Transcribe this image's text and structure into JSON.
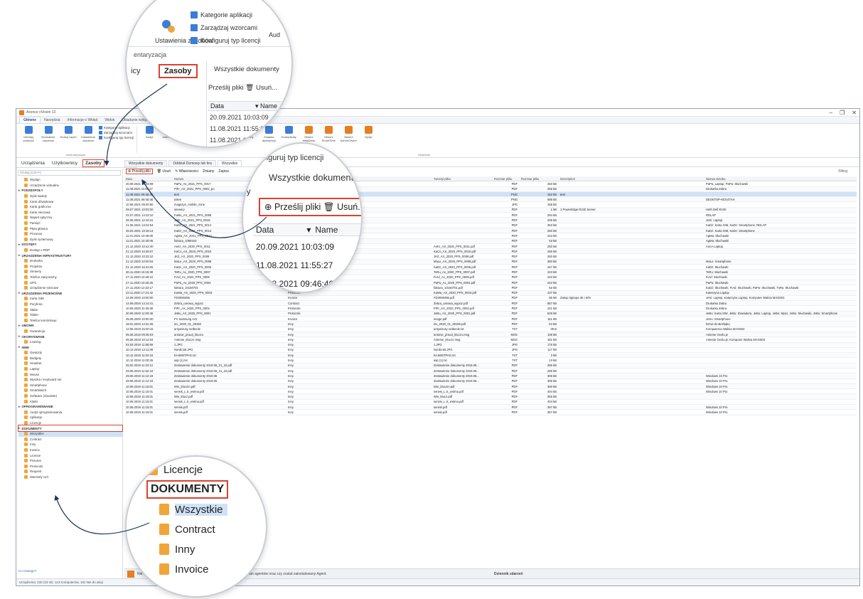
{
  "window": {
    "title": "Axence nVision 13",
    "controls": [
      "–",
      "❐",
      "✕"
    ]
  },
  "menu_tabs": [
    "Główne",
    "Narzędzia",
    "Informacje o Wkład",
    "Widok",
    "Układanie wyłączeń"
  ],
  "ribbon": {
    "buttons": [
      {
        "label": "Genetyj podsuidi",
        "color": "#3b7dd8"
      },
      {
        "label": "Normalizer zasobów",
        "color": "#3b7dd8"
      },
      {
        "label": "Drukuj raport",
        "color": "#3b7dd8"
      },
      {
        "label": "Ustawienia zasobów",
        "color": "#3b7dd8"
      },
      {
        "label": "Audyt",
        "color": "#3b7dd8"
      },
      {
        "label": "Ustawienia",
        "color": "#3b7dd8"
      },
      {
        "label": "Konfiguruj typ licencji",
        "color": "#3b7dd8"
      },
      {
        "label": "Procedury",
        "color": "#3b7dd8"
      },
      {
        "label": "Historia",
        "color": "#3b7dd8"
      },
      {
        "label": "Alarmy",
        "color": "#3b7dd8"
      },
      {
        "label": "Zadania dystrybucji",
        "color": "#3b7dd8"
      },
      {
        "label": "Komunikaty",
        "color": "#3b7dd8"
      },
      {
        "label": "Otwórz HelpDesk",
        "color": "#e67e22"
      },
      {
        "label": "Otwórz SmartTime",
        "color": "#e67e22"
      },
      {
        "label": "Otwórz AdminCenter",
        "color": "#e67e22"
      },
      {
        "label": "Opcje",
        "color": "#e67e22"
      }
    ],
    "small_items": [
      "Kategorie aplikacji",
      "Zarządzaj wzorcami",
      "Konfiguruj typ licencji"
    ],
    "group_inwentaryzacja": "Inwentaryzacja",
    "group_helpdesk": "HelpDesk"
  },
  "nav_tabs": [
    "Urządzenia",
    "Użytkownicy",
    "Zasoby"
  ],
  "sidebar": {
    "search_placeholder": "Szukaj (Ctrl+F)",
    "tree": [
      {
        "t": "Wydajn",
        "k": "leaf"
      },
      {
        "t": "Urządzenie wirtualne",
        "k": "leaf"
      },
      {
        "t": "PODZESPOŁY",
        "k": "cat"
      },
      {
        "t": "Dysk twardy",
        "k": "leaf"
      },
      {
        "t": "Karta dźwiękowa",
        "k": "leaf"
      },
      {
        "t": "Karta graficzna",
        "k": "leaf"
      },
      {
        "t": "Karta sieciowa",
        "k": "leaf"
      },
      {
        "t": "Napęd optyczny",
        "k": "leaf"
      },
      {
        "t": "Pamięć",
        "k": "leaf"
      },
      {
        "t": "Płyta główna",
        "k": "leaf"
      },
      {
        "t": "Procesor",
        "k": "leaf"
      },
      {
        "t": "Dysk systemowy",
        "k": "leaf"
      },
      {
        "t": "DOSTĘPY",
        "k": "cat"
      },
      {
        "t": "Dostęp o RDP",
        "k": "leaf"
      },
      {
        "t": "URZĄDZENIA INFRASTRUKTURY",
        "k": "cat"
      },
      {
        "t": "Drukarka",
        "k": "leaf"
      },
      {
        "t": "Projektor",
        "k": "leaf"
      },
      {
        "t": "Serwery",
        "k": "leaf"
      },
      {
        "t": "Telefon stacjonarny",
        "k": "leaf"
      },
      {
        "t": "UPS",
        "k": "leaf"
      },
      {
        "t": "Urządzenie sieciowe",
        "k": "leaf"
      },
      {
        "t": "URZĄDZENIA PRZENOŚNE",
        "k": "cat"
      },
      {
        "t": "Karta SIM",
        "k": "leaf"
      },
      {
        "t": "Peryferia",
        "k": "leaf"
      },
      {
        "t": "Słabe",
        "k": "leaf"
      },
      {
        "t": "Tablet",
        "k": "leaf"
      },
      {
        "t": "Telefon komórkowy",
        "k": "leaf"
      },
      {
        "t": "UMOWA",
        "k": "cat"
      },
      {
        "t": "Gwarancja",
        "k": "leaf"
      },
      {
        "t": "OKORVSWANE",
        "k": "cat"
      },
      {
        "t": "Leasing",
        "k": "leaf"
      },
      {
        "t": "INNE",
        "k": "cat"
      },
      {
        "t": "Gwiazdy",
        "k": "leaf"
      },
      {
        "t": "Budgety",
        "k": "leaf"
      },
      {
        "t": "Headset",
        "k": "leaf"
      },
      {
        "t": "Laptop",
        "k": "leaf"
      },
      {
        "t": "Mouse",
        "k": "leaf"
      },
      {
        "t": "Myszka / Keyboard set",
        "k": "leaf"
      },
      {
        "t": "Smartphone",
        "k": "leaf"
      },
      {
        "t": "Smartwatch",
        "k": "leaf"
      },
      {
        "t": "Software (obsolete)",
        "k": "leaf"
      },
      {
        "t": "Klatki",
        "k": "leaf"
      },
      {
        "t": "OPROGRAMOWANIE",
        "k": "cat"
      },
      {
        "t": "Audyt oprogramowania",
        "k": "leaf"
      },
      {
        "t": "Aplikacje",
        "k": "leaf"
      },
      {
        "t": "Licencje",
        "k": "leaf"
      },
      {
        "t": "DOKUMENTY",
        "k": "cat",
        "hl": true
      },
      {
        "t": "Wszystkie",
        "k": "leaf",
        "sel": true
      },
      {
        "t": "Contract",
        "k": "leaf"
      },
      {
        "t": "Inny",
        "k": "leaf"
      },
      {
        "t": "Invoice",
        "k": "leaf"
      },
      {
        "t": "License",
        "k": "leaf"
      },
      {
        "t": "Pictures",
        "k": "leaf"
      },
      {
        "t": "Protocols",
        "k": "leaf"
      },
      {
        "t": "Request",
        "k": "leaf"
      },
      {
        "t": "Warranty cert",
        "k": "leaf"
      }
    ],
    "footer": "Co nowego?"
  },
  "doc_tabs": [
    "Wszystkie dokumenty",
    "Oddział Domowy lub bra",
    "Wszystkie"
  ],
  "doc_toolbar": {
    "upload": "Prześlij pliki",
    "delete": "Usuń",
    "properties": "Właściwości",
    "download": "Zmiany",
    "save": "Zapisz",
    "filter": "Filtruj:"
  },
  "grid": {
    "columns": [
      "Data",
      "Nazwa",
      "Typ",
      "Tworzył pliku",
      "Rozmiar pliku",
      "Rozmiar pliku",
      "Description",
      "Nazwa zasobu"
    ],
    "rows": [
      [
        "20.09.2021 10:03:09",
        "PaPa_As_2021_PPS_0017",
        "",
        "",
        "PDF",
        "250 kB",
        "",
        "PaPa: Laptop, PaPa: Słuchawki"
      ],
      [
        "11.08.2021 11:55:27",
        "PiFr_AX_2021_PPS_0002_po",
        "",
        "",
        "PDF",
        "255 kB",
        "",
        "Drukarka Zebra"
      ],
      [
        "11.08.2021 09:46:46",
        "test",
        "",
        "",
        "PNG",
        "152 kB",
        "test",
        "",
        true
      ],
      [
        "11.08.2021 09:45:45",
        "token",
        "",
        "",
        "PNG",
        "595 kB",
        "",
        "DESKTOP-KEG4TAH"
      ],
      [
        "10.08.2021 09:40:50",
        "magazyn_mobile_zone",
        "",
        "",
        "JPG",
        "158 kB",
        "",
        ""
      ],
      [
        "09.07.2021 10:03:20",
        "serwery",
        "",
        "",
        "PDF",
        "1 kB",
        "1 PowerEdge R240 Server",
        "Hoth Dell R240"
      ],
      [
        "02.07.2021 14:23:10",
        "Faktu_AX_2021_PPS_0006",
        "",
        "",
        "PDF",
        "294 kB",
        "",
        "RDLAP"
      ],
      [
        "26.06.2021 12:10:41",
        "JeBr_AX_2021_PPS_0016",
        "",
        "",
        "PDF",
        "235 kB",
        "",
        "JeSi: Laptop"
      ],
      [
        "21.06.2021 13:24:54",
        "KaDz_AX_2021_PPS_0014",
        "",
        "",
        "PDF",
        "353 kB",
        "",
        "KaDz: Karta SIM, KaDz: Smartphone, RDLAP"
      ],
      [
        "28.02.2021 10:18:14",
        "KaDz_AX_2021_PPS_0013",
        "",
        "",
        "PDF",
        "260 kB",
        "",
        "KaDz: Karta SIM, KaDz: Smartphone"
      ],
      [
        "11.01.2021 10:45:06",
        "AgMa_AX_2021_PPS_0012",
        "",
        "",
        "PDF",
        "243 kB",
        "",
        "AgMa: Słuchawki"
      ],
      [
        "11.01.2021 10:40:06",
        "faktura_1098343",
        "",
        "",
        "PDF",
        "53 kB",
        "",
        "AgMa: Słuchawki"
      ],
      [
        "21.12.2020 10:42:40",
        "AnKr_AX_2020_PPS_0011",
        "Protocols",
        "AnKr_AX_2020_PPS_0011.pdf",
        "PDF",
        "250 kB",
        "",
        "AnnA Laptop"
      ],
      [
        "21.12.2020 10:35:07",
        "KaCo_AX_2020_PPS_0010",
        "Protocols",
        "KaCo_AX_2020_PPS_0010.pdf",
        "PDF",
        "255 kB",
        "",
        ""
      ],
      [
        "21.12.2020 10:33:10",
        "JKZ_AX_2020_PPS_0009",
        "Protocols",
        "JKZ_AX_2020_PPS_0009.pdf",
        "PDF",
        "250 kB",
        "",
        ""
      ],
      [
        "21.12.2020 10:00:04",
        "MaLe_AX_2020_PPS_0008",
        "Protocols",
        "MaLe_AX_2020_PPS_0008.pdf",
        "PDF",
        "350 kB",
        "",
        "MaLe: Smartphone"
      ],
      [
        "01.12.2020 16:23:25",
        "KaDz_AX_2020_PPS_0005",
        "Protocols",
        "KaDz_AX_2020_PPS_0005.pdf",
        "PDF",
        "247 kB",
        "",
        "KaDz: Słuchawki"
      ],
      [
        "30.11.2020 15:15:38",
        "ToRu_Ax_2020_PPS_0007",
        "Protocols",
        "ToRu_Ax_2020_PPS_0007.pdf",
        "PDF",
        "243 kB",
        "",
        "ToRu: Słuchawki"
      ],
      [
        "27.11.2020 10:46:24",
        "FiAd_Ax_2020_PPS_0006",
        "Protocols",
        "FiAd_Ax_2020_PPS_0006.pdf",
        "PDF",
        "243 kB",
        "",
        "FiAd: Słuchawki"
      ],
      [
        "27.11.2020 10:40:25",
        "PaPa_Ax_2020_PPS_0004",
        "Protocols",
        "PaPa_Ax_2020_PPS_0004.pdf",
        "PDF",
        "243 kB",
        "",
        "PaPa: Słuchawki"
      ],
      [
        "27.11.2020 12:23:17",
        "faktura_10150701",
        "Invoice",
        "faktura_10150701.pdf",
        "PDF",
        "82 kB",
        "",
        "KaDz: Słuchawki, FiAd: Słuchawki, PaPa: Słuchawki, ToRu: Słuchawki"
      ],
      [
        "23.11.2020 17:21:42",
        "KaWa_AX_2020_PPS_0003",
        "Protocols",
        "KaWa_AX_2020_PPS_0003.pdf",
        "PDF",
        "237 kB",
        "",
        "Katarzyna Laptop"
      ],
      [
        "24.09.2020 10:50:00",
        "FD0090455",
        "Invoice",
        "FD0090455.pdf",
        "PDF",
        "85 kB",
        "Zakup laptopa 4K i IEN",
        "JeSi: Laptop, Katarzyna Laptop, Komputer Walnia MAG503"
      ],
      [
        "14.09.2020 14:14:41",
        "Zebra_umowa_wypoz",
        "Contract",
        "Zebra_umowa_wypoz.pdf",
        "PDF",
        "857 kB",
        "",
        "Drukarka Zebra"
      ],
      [
        "10.09.2020 11:45:38",
        "PiPr_AX_2020_PPS_0002",
        "Protocols",
        "PiPr_AX_2020_PPS_0002.pdf",
        "PDF",
        "241 kB",
        "",
        "Drukarka Zebra"
      ],
      [
        "30.09.2020 11:00:46",
        "JeBu_AX_2020_PPS_0001",
        "Protocols",
        "JeBu_AX_2020_PPS_0001.pdf",
        "PDF",
        "528 kB",
        "",
        "JeBu: Karta SIM, JeBu: Klawiatura, JeBu: Laptop, JeBu: Mysz, JeBu: Słuchawki, JeBu: Smartphone"
      ],
      [
        "25.06.2020 10:00:30",
        "FV Samsung A41",
        "Invoice",
        "image.pdf",
        "PDF",
        "151 kB",
        "",
        "JeSu: Smartphone"
      ],
      [
        "18.01.2020 14:31:25",
        "inv_2020_01_28150",
        "Inny",
        "inv_2020_01_28150.pdf",
        "PDF",
        "64 kB",
        "",
        "Drzwi do Bezbąku"
      ],
      [
        "12.06.2019 15:40:15",
        "antywirusy netbeole",
        "Inny",
        "antywirusy netbeole.txt",
        "TXT",
        "39 B",
        "",
        "Komputeroo Walnia MAG503"
      ],
      [
        "05.06.2019 09:35:03",
        "antonie_proud_kluczo",
        "Inny",
        "antonie_proud_kluczo.msg",
        "MSG",
        "108 kB",
        "",
        "Antenie Geolu.je"
      ],
      [
        "05.06.2019 10:12:04",
        "Antenie_kluczo msg",
        "Inny",
        "Antenie_kluczo msg",
        "MSG",
        "161 kB",
        "",
        "Antenie Geolu.je, Komputer Walnia MAG503"
      ],
      [
        "04.03.2019 11:58:59",
        "1.JPG",
        "Inny",
        "1.JPG",
        "JPG",
        "175 kB",
        "",
        ""
      ],
      [
        "10.12.2018 13:11:08",
        "Nordic1B.JPG",
        "Inny",
        "Nordic1B.JPG",
        "JPG",
        "117 kB",
        "",
        ""
      ],
      [
        "10.12.2018 11:02:16",
        "EASEBTPAG.txt",
        "Inny",
        "EASEBTPAG.txt",
        "TXT",
        "2 kB",
        "",
        ""
      ],
      [
        "10.12.2018 11:00:26",
        "asp (1).txt",
        "Inny",
        "asp (1).txt",
        "TXT",
        "13 kB",
        "",
        ""
      ],
      [
        "26.02.2019 11:23:12",
        "Zestawienie dokumenty 2019.06_21_22.pdf",
        "Inny",
        "Zestawienie dokumenty 2019.06...",
        "PDF",
        "286 kB",
        "",
        ""
      ],
      [
        "29.06.2019 11:52:18",
        "Zestawienie dokumenty 2019.06_21_22.pdf",
        "Inny",
        "Zestawienie dokumenty 2019.06...",
        "PDF",
        "285 kB",
        "",
        ""
      ],
      [
        "29.06.2019 11:12:18",
        "Zestawienie dokumenty 2019.06",
        "Inny",
        "Zestawienie dokumenty 2019.06...",
        "PDF",
        "306 kB",
        "",
        "Windows 10 Pro"
      ],
      [
        "29.06.2019 11:12:18",
        "Zestawienie dokumenty 2019.06",
        "Inny",
        "Zestawienie dokumenty 2019.06...",
        "PDF",
        "305 kB",
        "",
        "Windows 10 Pro"
      ],
      [
        "10.06.2019 11:15:01",
        "Win_kluczm.pdf",
        "Inny",
        "Win_kluczm.pdf",
        "PDF",
        "300 kB",
        "",
        "Windows 10 Pro"
      ],
      [
        "10.06.2019 11:15:01",
        "serwis_L.S_wstma.pdf",
        "Inny",
        "serwis_L.S_wstma.pdf",
        "PDF",
        "404 kB",
        "",
        "Windows 10 Pro"
      ],
      [
        "10.06.2019 11:15:01",
        "Win_klucz.pdf",
        "Inny",
        "Win_klucz.pdf",
        "PDF",
        "355 kB",
        "",
        ""
      ],
      [
        "10.06.2019 11:15:01",
        "serwis_L.S_wstma.pdf",
        "Inny",
        "serwis_L.S_wstma.pdf",
        "PDF",
        "404 kB",
        "",
        ""
      ],
      [
        "10.06.2019 11:15:01",
        "serwis.pdf",
        "Inny",
        "serwis.pdf",
        "PDF",
        "367 kB",
        "",
        "Windows 10 Pro"
      ],
      [
        "10.06.2019 11:15:01",
        "serwis.pdf",
        "Inny",
        "serwis.pdf",
        "PDF",
        "367 kB",
        "",
        "Windows 10 Pro"
      ]
    ]
  },
  "bottom": {
    "warning": "Nie znaleziono agentów zainstalowanych lub są wyłączone. Sprawdź stan agentów oraz czy został zainstalowany Agent.",
    "event_log": "Dziennik zdarzeń",
    "status": "Urządzenia: 230 (23 W), 113 Komputerów, 101 Nie do akcji"
  },
  "magnifier1": {
    "menu": [
      "Kategorie aplikacji",
      "Zarządzaj wzorcami",
      "Konfiguruj typ licencji"
    ],
    "big_label": "Ustawienia zasobów",
    "group": "entaryzacja",
    "tab_prev": "icy",
    "tab_active": "Zasoby",
    "doc_tab": "Wszystkie dokumenty",
    "doc_tab_next": "O",
    "toolbar": "Prześlij pliki  🗑 Usuń...",
    "col_date": "Data",
    "col_name": "Name",
    "rows": [
      {
        "date": "20.09.2021 10:03:09",
        "name": "PaPa"
      },
      {
        "date": "11.08.2021 11:55:27",
        "name": "P"
      },
      {
        "date": "11.08.2021 09:46:46",
        "name": ""
      },
      {
        "date": "11.08.2021 09:45:47",
        "name": ""
      }
    ],
    "partial": "Aud"
  },
  "magnifier2": {
    "header": "Konfiguruj typ licencji",
    "tab_left": "by",
    "doc_tab": "Wszystkie dokumenty",
    "doc_tab_next": "Ou",
    "upload": "Prześlij pliki",
    "delete": "Usuń...",
    "col_date": "Data",
    "col_name": "Name",
    "rows": [
      {
        "date": "20.09.2021 10:03:09",
        "name": "PaPa_A"
      },
      {
        "date": "11.08.2021 11:55:27",
        "name": "PiFr_"
      },
      {
        "date": "11.08.2021 09:46:46",
        "name": "test"
      }
    ]
  },
  "magnifier3": {
    "items": [
      "Licencje",
      "DOKUMENTY",
      "Wszystkie",
      "Contract",
      "Inny",
      "Invoice"
    ]
  },
  "colors": {
    "highlight": "#d9432f",
    "selection": "#cfe2f7",
    "folder": "#f0a53a",
    "accent": "#3b7dd8"
  }
}
